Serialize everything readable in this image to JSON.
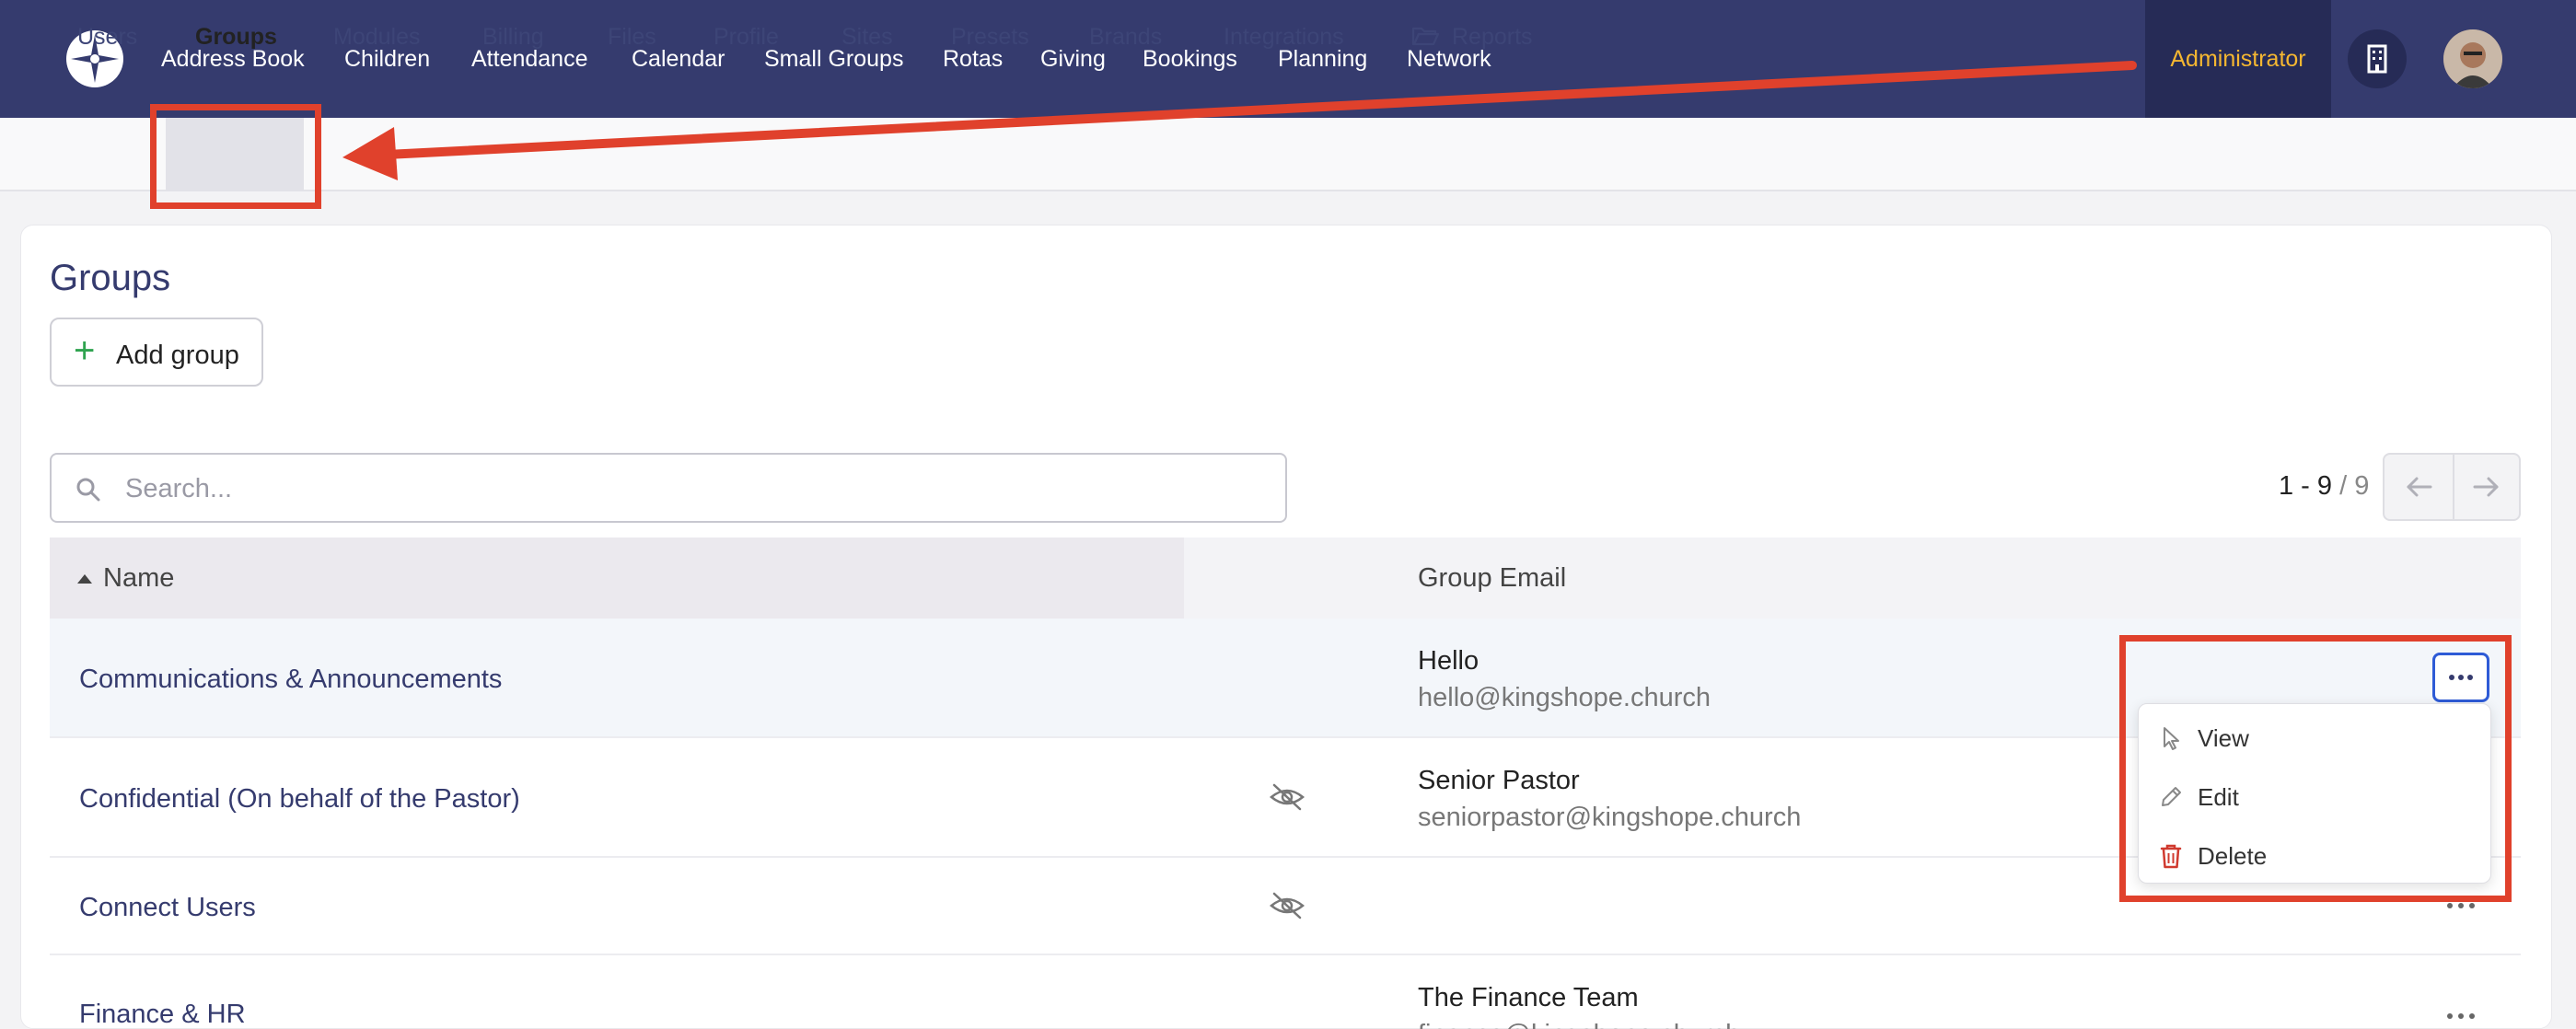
{
  "topnav": {
    "items": [
      "Address Book",
      "Children",
      "Attendance",
      "Calendar",
      "Small Groups",
      "Rotas",
      "Giving",
      "Bookings",
      "Planning",
      "Network"
    ],
    "admin_label": "Administrator"
  },
  "subnav": {
    "items": [
      "Users",
      "Groups",
      "Modules",
      "Billing",
      "Files",
      "Profile",
      "Sites",
      "Presets",
      "Brands",
      "Integrations",
      "Reports"
    ],
    "active": "Groups"
  },
  "page": {
    "title": "Groups",
    "add_button": "Add group",
    "search_placeholder": "Search...",
    "pager_range": "1 - 9",
    "pager_total": "/ 9"
  },
  "table": {
    "headers": {
      "name": "Name",
      "email": "Group Email"
    },
    "rows": [
      {
        "name": "Communications & Announcements",
        "email_title": "Hello",
        "email_addr": "hello@kingshope.church",
        "hidden": false
      },
      {
        "name": "Confidential (On behalf of the Pastor)",
        "email_title": "Senior Pastor",
        "email_addr": "seniorpastor@kingshope.church",
        "hidden": true
      },
      {
        "name": "Connect Users",
        "email_title": "",
        "email_addr": "",
        "hidden": true
      },
      {
        "name": "Finance & HR",
        "email_title": "The Finance Team",
        "email_addr": "finance@kingshope.church",
        "hidden": false
      }
    ]
  },
  "menu": {
    "items": [
      {
        "label": "View",
        "icon": "cursor-icon"
      },
      {
        "label": "Edit",
        "icon": "pencil-icon"
      },
      {
        "label": "Delete",
        "icon": "trash-icon"
      }
    ]
  },
  "colors": {
    "topbar": "#353b6e",
    "admin_bg": "#262b56",
    "admin_text": "#f5b731",
    "annotation": "#e0412c",
    "link": "#353b6e",
    "danger": "#d03a2f",
    "add_plus": "#2fa34f"
  }
}
